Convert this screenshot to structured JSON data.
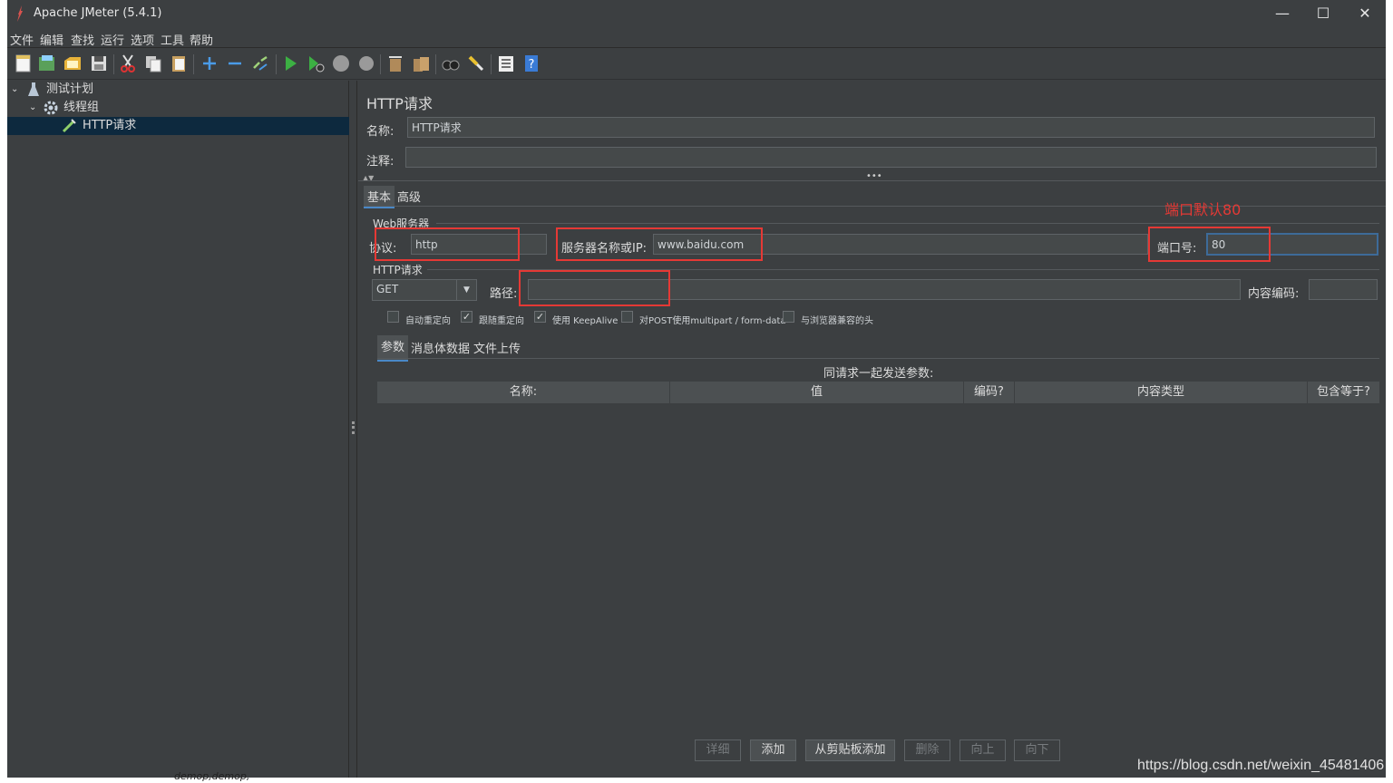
{
  "window": {
    "title": "Apache JMeter (5.4.1)",
    "minimize": "—",
    "maximize": "☐",
    "close": "✕"
  },
  "menu": [
    "文件",
    "编辑",
    "查找",
    "运行",
    "选项",
    "工具",
    "帮助"
  ],
  "toolbar_icons": [
    "new-icon",
    "templates-icon",
    "open-icon",
    "save-icon",
    "cut-icon",
    "copy-icon",
    "paste-icon",
    "expand-icon",
    "collapse-icon",
    "toggle-icon",
    "start-icon",
    "start-no-pause-icon",
    "stop-icon",
    "shutdown-icon",
    "clear-icon",
    "clear-all-icon",
    "search-icon",
    "reset-search-icon",
    "function-helper-icon",
    "help-icon"
  ],
  "tree": {
    "items": [
      {
        "label": "测试计划",
        "icon": "test-plan-icon"
      },
      {
        "label": "线程组",
        "icon": "thread-group-icon"
      },
      {
        "label": "HTTP请求",
        "icon": "http-sampler-icon"
      }
    ]
  },
  "panel": {
    "title": "HTTP请求",
    "name_label": "名称:",
    "name_value": "HTTP请求",
    "comment_label": "注释:",
    "comment_value": ""
  },
  "tabs": [
    "基本",
    "高级"
  ],
  "web_server": {
    "group_label": "Web服务器",
    "protocol_label": "协议:",
    "protocol_value": "http",
    "server_label": "服务器名称或IP:",
    "server_value": "www.baidu.com",
    "port_label": "端口号:",
    "port_value": "80"
  },
  "http_request": {
    "group_label": "HTTP请求",
    "method": "GET",
    "path_label": "路径:",
    "path_value": "",
    "encoding_label": "内容编码:",
    "encoding_value": ""
  },
  "options": [
    {
      "label": "自动重定向",
      "checked": false
    },
    {
      "label": "跟随重定向",
      "checked": true
    },
    {
      "label": "使用 KeepAlive",
      "checked": true
    },
    {
      "label": "对POST使用multipart / form-data",
      "checked": false
    },
    {
      "label": "与浏览器兼容的头",
      "checked": false
    }
  ],
  "check_mark": "✓",
  "subtabs": [
    "参数",
    "消息体数据",
    "文件上传"
  ],
  "params": {
    "caption": "同请求一起发送参数:",
    "columns": [
      "名称:",
      "值",
      "编码?",
      "内容类型",
      "包含等于?"
    ]
  },
  "buttons": [
    {
      "label": "详细",
      "enabled": false
    },
    {
      "label": "添加",
      "enabled": true
    },
    {
      "label": "从剪贴板添加",
      "enabled": true
    },
    {
      "label": "删除",
      "enabled": false
    },
    {
      "label": "向上",
      "enabled": false
    },
    {
      "label": "向下",
      "enabled": false
    }
  ],
  "annotation": "端口默认80",
  "watermark": "https://blog.csdn.net/weixin_45481406",
  "outside_text": "demop,demop,",
  "colors": {
    "annotation": "#e53935",
    "selection": "#0d293e",
    "background": "#3c3f41"
  }
}
